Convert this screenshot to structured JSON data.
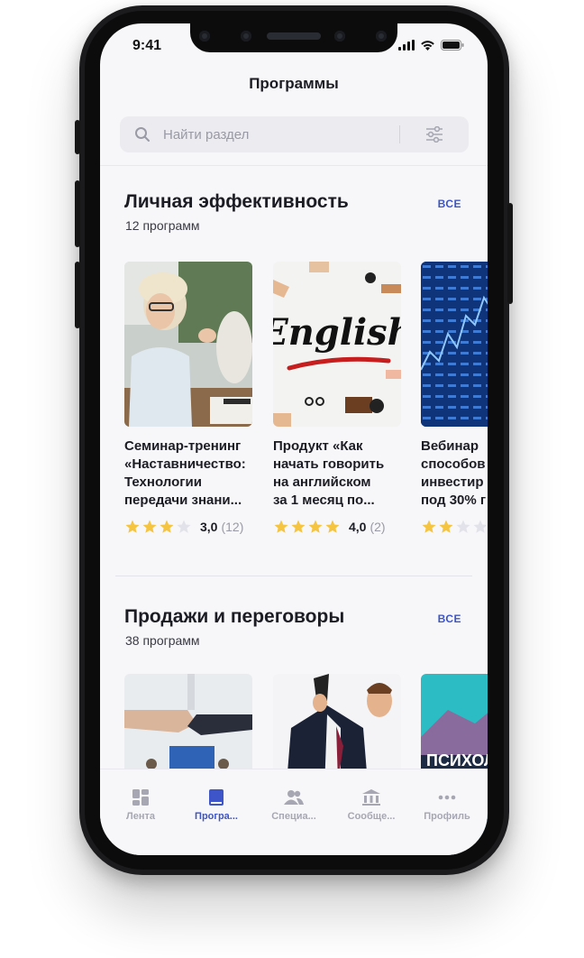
{
  "status_bar": {
    "time": "9:41"
  },
  "header": {
    "title": "Программы"
  },
  "search": {
    "placeholder": "Найти раздел"
  },
  "sections": [
    {
      "title": "Личная эффективность",
      "count": "12 программ",
      "all_label": "ВСЕ",
      "cards": [
        {
          "title": "Семинар-тренинг\n«Наставничество:\nТехнологии\nпередачи знани...",
          "rating": "3,0",
          "reviews": "(12)",
          "stars": 3
        },
        {
          "title": "Продукт «Как\nначать говорить\nна английском\nза 1 месяц по...",
          "rating": "4,0",
          "reviews": "(2)",
          "stars": 4,
          "image_text": "English"
        },
        {
          "title": "Вебинар\nспособов\nинвестир\nпод 30% г",
          "stars": 2
        }
      ]
    },
    {
      "title": "Продажи и переговоры",
      "count": "38 программ",
      "all_label": "ВСЕ",
      "cards": [
        {
          "image": "handshake"
        },
        {
          "image": "man-on-phone"
        },
        {
          "image": "psychology",
          "image_text": "ПСИХОЛОГ"
        }
      ]
    }
  ],
  "tabbar": {
    "items": [
      {
        "label": "Лента",
        "icon": "feed-icon",
        "active": false
      },
      {
        "label": "Програ...",
        "icon": "book-icon",
        "active": true
      },
      {
        "label": "Специа...",
        "icon": "people-icon",
        "active": false
      },
      {
        "label": "Сообще...",
        "icon": "institution-icon",
        "active": false
      },
      {
        "label": "Профиль",
        "icon": "more-icon",
        "active": false
      }
    ]
  },
  "colors": {
    "accent": "#3d55c9",
    "star_filled": "#f5c542",
    "star_empty": "#e2e2ea"
  }
}
